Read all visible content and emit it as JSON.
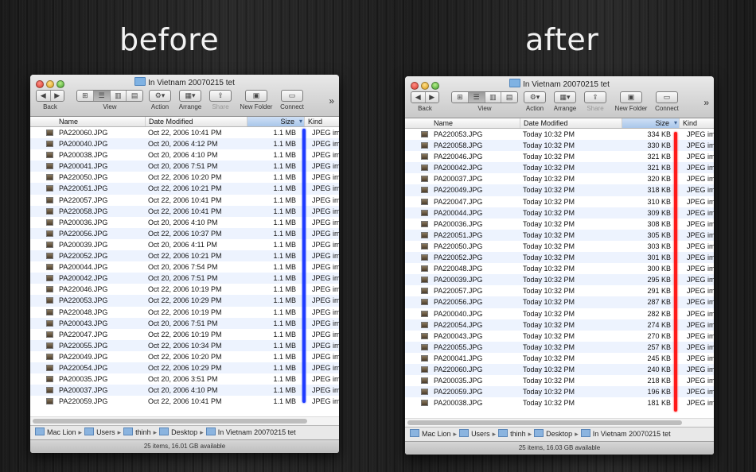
{
  "captions": {
    "before": "before",
    "after": "after"
  },
  "window_title": "In Vietnam 20070215 tet",
  "toolbar": {
    "back_label": "Back",
    "view_label": "View",
    "action_label": "Action",
    "arrange_label": "Arrange",
    "share_label": "Share",
    "new_folder_label": "New Folder",
    "connect_label": "Connect",
    "more": "»"
  },
  "columns": {
    "name": "Name",
    "date": "Date Modified",
    "size": "Size",
    "kind": "Kind"
  },
  "path": {
    "items": [
      "Mac Lion",
      "Users",
      "thinh",
      "Desktop",
      "In Vietnam 20070215 tet"
    ]
  },
  "before": {
    "status": "25 items, 16.01 GB available",
    "rows": [
      {
        "name": "PA220060.JPG",
        "date": "Oct 22, 2006 10:41 PM",
        "size": "1.1 MB",
        "kind": "JPEG im"
      },
      {
        "name": "PA200040.JPG",
        "date": "Oct 20, 2006 4:12 PM",
        "size": "1.1 MB",
        "kind": "JPEG im"
      },
      {
        "name": "PA200038.JPG",
        "date": "Oct 20, 2006 4:10 PM",
        "size": "1.1 MB",
        "kind": "JPEG im"
      },
      {
        "name": "PA200041.JPG",
        "date": "Oct 20, 2006 7:51 PM",
        "size": "1.1 MB",
        "kind": "JPEG im"
      },
      {
        "name": "PA220050.JPG",
        "date": "Oct 22, 2006 10:20 PM",
        "size": "1.1 MB",
        "kind": "JPEG im"
      },
      {
        "name": "PA220051.JPG",
        "date": "Oct 22, 2006 10:21 PM",
        "size": "1.1 MB",
        "kind": "JPEG im"
      },
      {
        "name": "PA220057.JPG",
        "date": "Oct 22, 2006 10:41 PM",
        "size": "1.1 MB",
        "kind": "JPEG im"
      },
      {
        "name": "PA220058.JPG",
        "date": "Oct 22, 2006 10:41 PM",
        "size": "1.1 MB",
        "kind": "JPEG im"
      },
      {
        "name": "PA200036.JPG",
        "date": "Oct 20, 2006 4:10 PM",
        "size": "1.1 MB",
        "kind": "JPEG im"
      },
      {
        "name": "PA220056.JPG",
        "date": "Oct 22, 2006 10:37 PM",
        "size": "1.1 MB",
        "kind": "JPEG im"
      },
      {
        "name": "PA200039.JPG",
        "date": "Oct 20, 2006 4:11 PM",
        "size": "1.1 MB",
        "kind": "JPEG im"
      },
      {
        "name": "PA220052.JPG",
        "date": "Oct 22, 2006 10:21 PM",
        "size": "1.1 MB",
        "kind": "JPEG im"
      },
      {
        "name": "PA200044.JPG",
        "date": "Oct 20, 2006 7:54 PM",
        "size": "1.1 MB",
        "kind": "JPEG im"
      },
      {
        "name": "PA200042.JPG",
        "date": "Oct 20, 2006 7:51 PM",
        "size": "1.1 MB",
        "kind": "JPEG im"
      },
      {
        "name": "PA220046.JPG",
        "date": "Oct 22, 2006 10:19 PM",
        "size": "1.1 MB",
        "kind": "JPEG im"
      },
      {
        "name": "PA220053.JPG",
        "date": "Oct 22, 2006 10:29 PM",
        "size": "1.1 MB",
        "kind": "JPEG im"
      },
      {
        "name": "PA220048.JPG",
        "date": "Oct 22, 2006 10:19 PM",
        "size": "1.1 MB",
        "kind": "JPEG im"
      },
      {
        "name": "PA200043.JPG",
        "date": "Oct 20, 2006 7:51 PM",
        "size": "1.1 MB",
        "kind": "JPEG im"
      },
      {
        "name": "PA220047.JPG",
        "date": "Oct 22, 2006 10:19 PM",
        "size": "1.1 MB",
        "kind": "JPEG im"
      },
      {
        "name": "PA220055.JPG",
        "date": "Oct 22, 2006 10:34 PM",
        "size": "1.1 MB",
        "kind": "JPEG im"
      },
      {
        "name": "PA220049.JPG",
        "date": "Oct 22, 2006 10:20 PM",
        "size": "1.1 MB",
        "kind": "JPEG im"
      },
      {
        "name": "PA220054.JPG",
        "date": "Oct 22, 2006 10:29 PM",
        "size": "1.1 MB",
        "kind": "JPEG im"
      },
      {
        "name": "PA200035.JPG",
        "date": "Oct 20, 2006 3:51 PM",
        "size": "1.1 MB",
        "kind": "JPEG im"
      },
      {
        "name": "PA200037.JPG",
        "date": "Oct 20, 2006 4:10 PM",
        "size": "1.1 MB",
        "kind": "JPEG im"
      },
      {
        "name": "PA220059.JPG",
        "date": "Oct 22, 2006 10:41 PM",
        "size": "1.1 MB",
        "kind": "JPEG im"
      }
    ]
  },
  "after": {
    "status": "25 items, 16.03 GB available",
    "rows": [
      {
        "name": "PA220053.JPG",
        "date": "Today 10:32 PM",
        "size": "334 KB",
        "kind": "JPEG im"
      },
      {
        "name": "PA220058.JPG",
        "date": "Today 10:32 PM",
        "size": "330 KB",
        "kind": "JPEG im"
      },
      {
        "name": "PA220046.JPG",
        "date": "Today 10:32 PM",
        "size": "321 KB",
        "kind": "JPEG im"
      },
      {
        "name": "PA200042.JPG",
        "date": "Today 10:32 PM",
        "size": "321 KB",
        "kind": "JPEG im"
      },
      {
        "name": "PA200037.JPG",
        "date": "Today 10:32 PM",
        "size": "320 KB",
        "kind": "JPEG im"
      },
      {
        "name": "PA220049.JPG",
        "date": "Today 10:32 PM",
        "size": "318 KB",
        "kind": "JPEG im"
      },
      {
        "name": "PA220047.JPG",
        "date": "Today 10:32 PM",
        "size": "310 KB",
        "kind": "JPEG im"
      },
      {
        "name": "PA200044.JPG",
        "date": "Today 10:32 PM",
        "size": "309 KB",
        "kind": "JPEG im"
      },
      {
        "name": "PA200036.JPG",
        "date": "Today 10:32 PM",
        "size": "308 KB",
        "kind": "JPEG im"
      },
      {
        "name": "PA220051.JPG",
        "date": "Today 10:32 PM",
        "size": "305 KB",
        "kind": "JPEG im"
      },
      {
        "name": "PA220050.JPG",
        "date": "Today 10:32 PM",
        "size": "303 KB",
        "kind": "JPEG im"
      },
      {
        "name": "PA220052.JPG",
        "date": "Today 10:32 PM",
        "size": "301 KB",
        "kind": "JPEG im"
      },
      {
        "name": "PA220048.JPG",
        "date": "Today 10:32 PM",
        "size": "300 KB",
        "kind": "JPEG im"
      },
      {
        "name": "PA200039.JPG",
        "date": "Today 10:32 PM",
        "size": "295 KB",
        "kind": "JPEG im"
      },
      {
        "name": "PA220057.JPG",
        "date": "Today 10:32 PM",
        "size": "291 KB",
        "kind": "JPEG im"
      },
      {
        "name": "PA220056.JPG",
        "date": "Today 10:32 PM",
        "size": "287 KB",
        "kind": "JPEG im"
      },
      {
        "name": "PA200040.JPG",
        "date": "Today 10:32 PM",
        "size": "282 KB",
        "kind": "JPEG im"
      },
      {
        "name": "PA220054.JPG",
        "date": "Today 10:32 PM",
        "size": "274 KB",
        "kind": "JPEG im"
      },
      {
        "name": "PA200043.JPG",
        "date": "Today 10:32 PM",
        "size": "270 KB",
        "kind": "JPEG im"
      },
      {
        "name": "PA220055.JPG",
        "date": "Today 10:32 PM",
        "size": "257 KB",
        "kind": "JPEG im"
      },
      {
        "name": "PA200041.JPG",
        "date": "Today 10:32 PM",
        "size": "245 KB",
        "kind": "JPEG im"
      },
      {
        "name": "PA220060.JPG",
        "date": "Today 10:32 PM",
        "size": "240 KB",
        "kind": "JPEG im"
      },
      {
        "name": "PA200035.JPG",
        "date": "Today 10:32 PM",
        "size": "218 KB",
        "kind": "JPEG im"
      },
      {
        "name": "PA220059.JPG",
        "date": "Today 10:32 PM",
        "size": "196 KB",
        "kind": "JPEG im"
      },
      {
        "name": "PA200038.JPG",
        "date": "Today 10:32 PM",
        "size": "181 KB",
        "kind": "JPEG im"
      }
    ]
  },
  "colors": {
    "before_marker": "#1f3cff",
    "after_marker": "#ff1a1a",
    "sort_header": "#a9c6ea"
  }
}
